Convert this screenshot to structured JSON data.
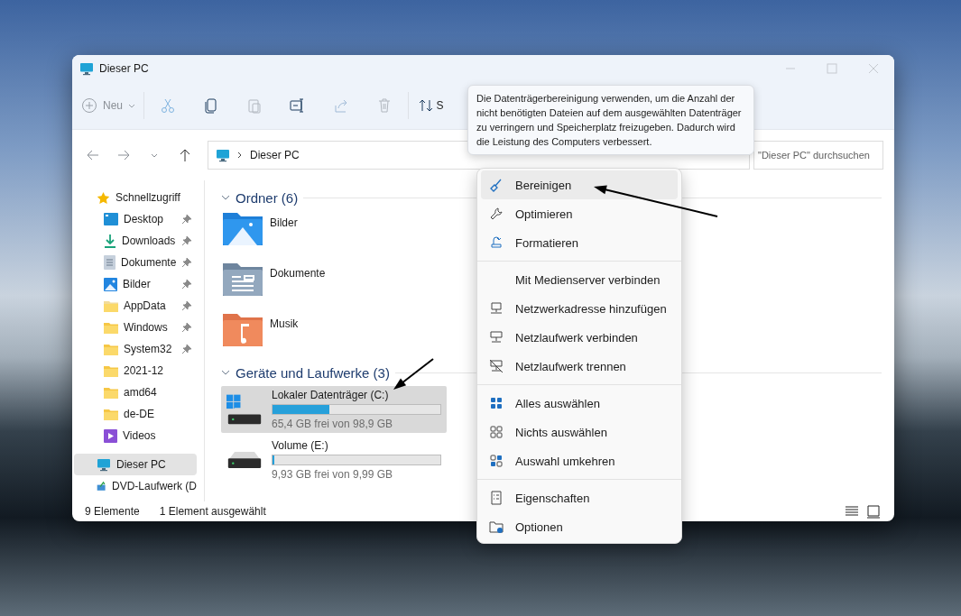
{
  "window": {
    "title": "Dieser PC"
  },
  "toolbar": {
    "new_label": "Neu",
    "sort_label": "S"
  },
  "navigation": {
    "path": "Dieser PC",
    "search": {
      "placeholder": "\"Dieser PC\" durchsuchen"
    }
  },
  "sidebar": {
    "items": [
      {
        "label": "Schnellzugriff",
        "selected": false,
        "children": [
          {
            "label": "Desktop",
            "pinned": true,
            "selected": false
          },
          {
            "label": "Downloads",
            "pinned": true,
            "selected": false
          },
          {
            "label": "Dokumente",
            "pinned": true,
            "selected": false
          },
          {
            "label": "Bilder",
            "pinned": true,
            "selected": false
          },
          {
            "label": "AppData",
            "pinned": true,
            "selected": false
          },
          {
            "label": "Windows",
            "pinned": true,
            "selected": false
          },
          {
            "label": "System32",
            "pinned": true,
            "selected": false
          },
          {
            "label": "2021-12",
            "pinned": false,
            "selected": false
          },
          {
            "label": "amd64",
            "pinned": false,
            "selected": false
          },
          {
            "label": "de-DE",
            "pinned": false,
            "selected": false
          },
          {
            "label": "Videos",
            "pinned": false,
            "selected": false
          }
        ]
      },
      {
        "label": "Dieser PC",
        "selected": true
      },
      {
        "label": "DVD-Laufwerk (D",
        "selected": false
      }
    ]
  },
  "sections": [
    {
      "kind": "folders",
      "title": "Ordner (6)",
      "expanded": true,
      "items": [
        {
          "label": "Bilder"
        },
        {
          "label": "Dokumente"
        },
        {
          "label": "Musik"
        }
      ]
    },
    {
      "kind": "drives",
      "title": "Geräte und Laufwerke (3)",
      "expanded": true,
      "items": [
        {
          "name": "Lokaler Datenträger (C:)",
          "free": "65,4 GB frei von 98,9 GB",
          "level": 0.34,
          "selected": true
        },
        {
          "name": "Volume (E:)",
          "free": "9,93 GB frei von 9,99 GB",
          "level": 0.01,
          "selected": false
        }
      ]
    }
  ],
  "context_menu": {
    "groups": [
      {
        "items": [
          {
            "label": "Bereinigen",
            "selected": true
          },
          {
            "label": "Optimieren",
            "selected": false
          },
          {
            "label": "Formatieren",
            "selected": false
          }
        ]
      },
      {
        "items": [
          {
            "label": "Mit Medienserver verbinden",
            "selected": false
          },
          {
            "label": "Netzwerkadresse hinzufügen",
            "selected": false
          },
          {
            "label": "Netzlaufwerk verbinden",
            "selected": false
          },
          {
            "label": "Netzlaufwerk trennen",
            "selected": false
          }
        ]
      },
      {
        "items": [
          {
            "label": "Alles auswählen",
            "selected": false
          },
          {
            "label": "Nichts auswählen",
            "selected": false
          },
          {
            "label": "Auswahl umkehren",
            "selected": false
          }
        ]
      },
      {
        "items": [
          {
            "label": "Eigenschaften",
            "selected": false
          },
          {
            "label": "Optionen",
            "selected": false
          }
        ]
      }
    ]
  },
  "tooltip": {
    "text": "Die Datenträgerbereinigung verwenden, um die Anzahl der nicht benötigten Dateien auf dem ausgewählten Datenträger zu verringern und Speicherplatz freizugeben. Dadurch wird die Leistung des Computers verbessert."
  },
  "status_bar": {
    "item_count": "9 Elemente",
    "selection": "1 Element ausgewählt"
  }
}
